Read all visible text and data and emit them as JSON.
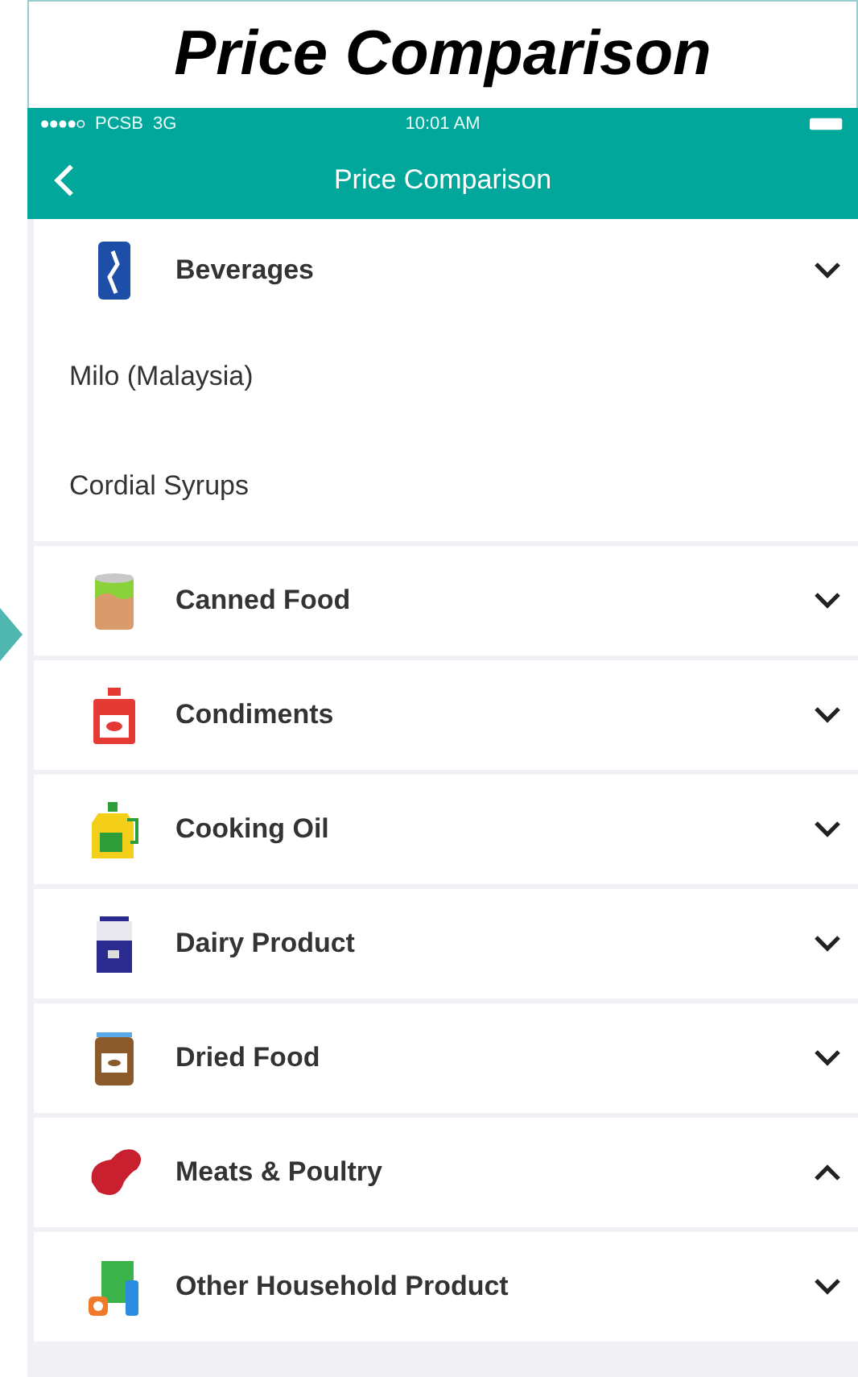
{
  "heading": "Price Comparison",
  "status_bar": {
    "carrier": "PCSB",
    "network": "3G",
    "time": "10:01 AM"
  },
  "nav": {
    "title": "Price Comparison"
  },
  "categories": [
    {
      "name": "Beverages",
      "expanded": false,
      "children": [
        "Milo (Malaysia)",
        "Cordial Syrups"
      ]
    },
    {
      "name": "Canned Food",
      "expanded": false
    },
    {
      "name": "Condiments",
      "expanded": false
    },
    {
      "name": "Cooking Oil",
      "expanded": false
    },
    {
      "name": "Dairy Product",
      "expanded": false
    },
    {
      "name": "Dried Food",
      "expanded": false
    },
    {
      "name": "Meats & Poultry",
      "expanded": true
    },
    {
      "name": "Other Household Product",
      "expanded": false
    }
  ]
}
